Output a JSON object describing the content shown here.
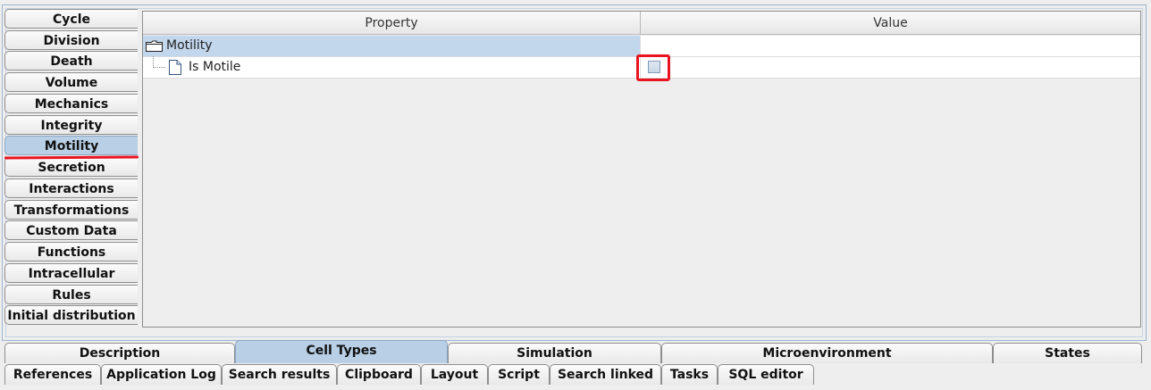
{
  "side_tabs": [
    "Cycle",
    "Division",
    "Death",
    "Volume",
    "Mechanics",
    "Integrity",
    "Motility",
    "Secretion",
    "Interactions",
    "Transformations",
    "Custom Data",
    "Functions",
    "Intracellular",
    "Rules",
    "Initial distribution"
  ],
  "active_side_tab": "Motility",
  "table": {
    "headers": {
      "property": "Property",
      "value": "Value"
    },
    "rows": [
      {
        "label": "Motility",
        "icon": "folder-icon",
        "selected": true
      },
      {
        "label": "Is Motile",
        "icon": "file-icon",
        "value_type": "checkbox",
        "checked": false
      }
    ]
  },
  "bottom_tabs_row1": [
    "Description",
    "Cell Types",
    "Simulation",
    "Microenvironment",
    "States"
  ],
  "active_bottom_tab": "Cell Types",
  "bottom_tabs_row2": [
    "References",
    "Application Log",
    "Search results",
    "Clipboard",
    "Layout",
    "Script",
    "Search linked",
    "Tasks",
    "SQL editor"
  ],
  "colors": {
    "accent": "#b8cfe5",
    "annotation": "#e8141f",
    "selected_row": "#c2d6ec"
  }
}
